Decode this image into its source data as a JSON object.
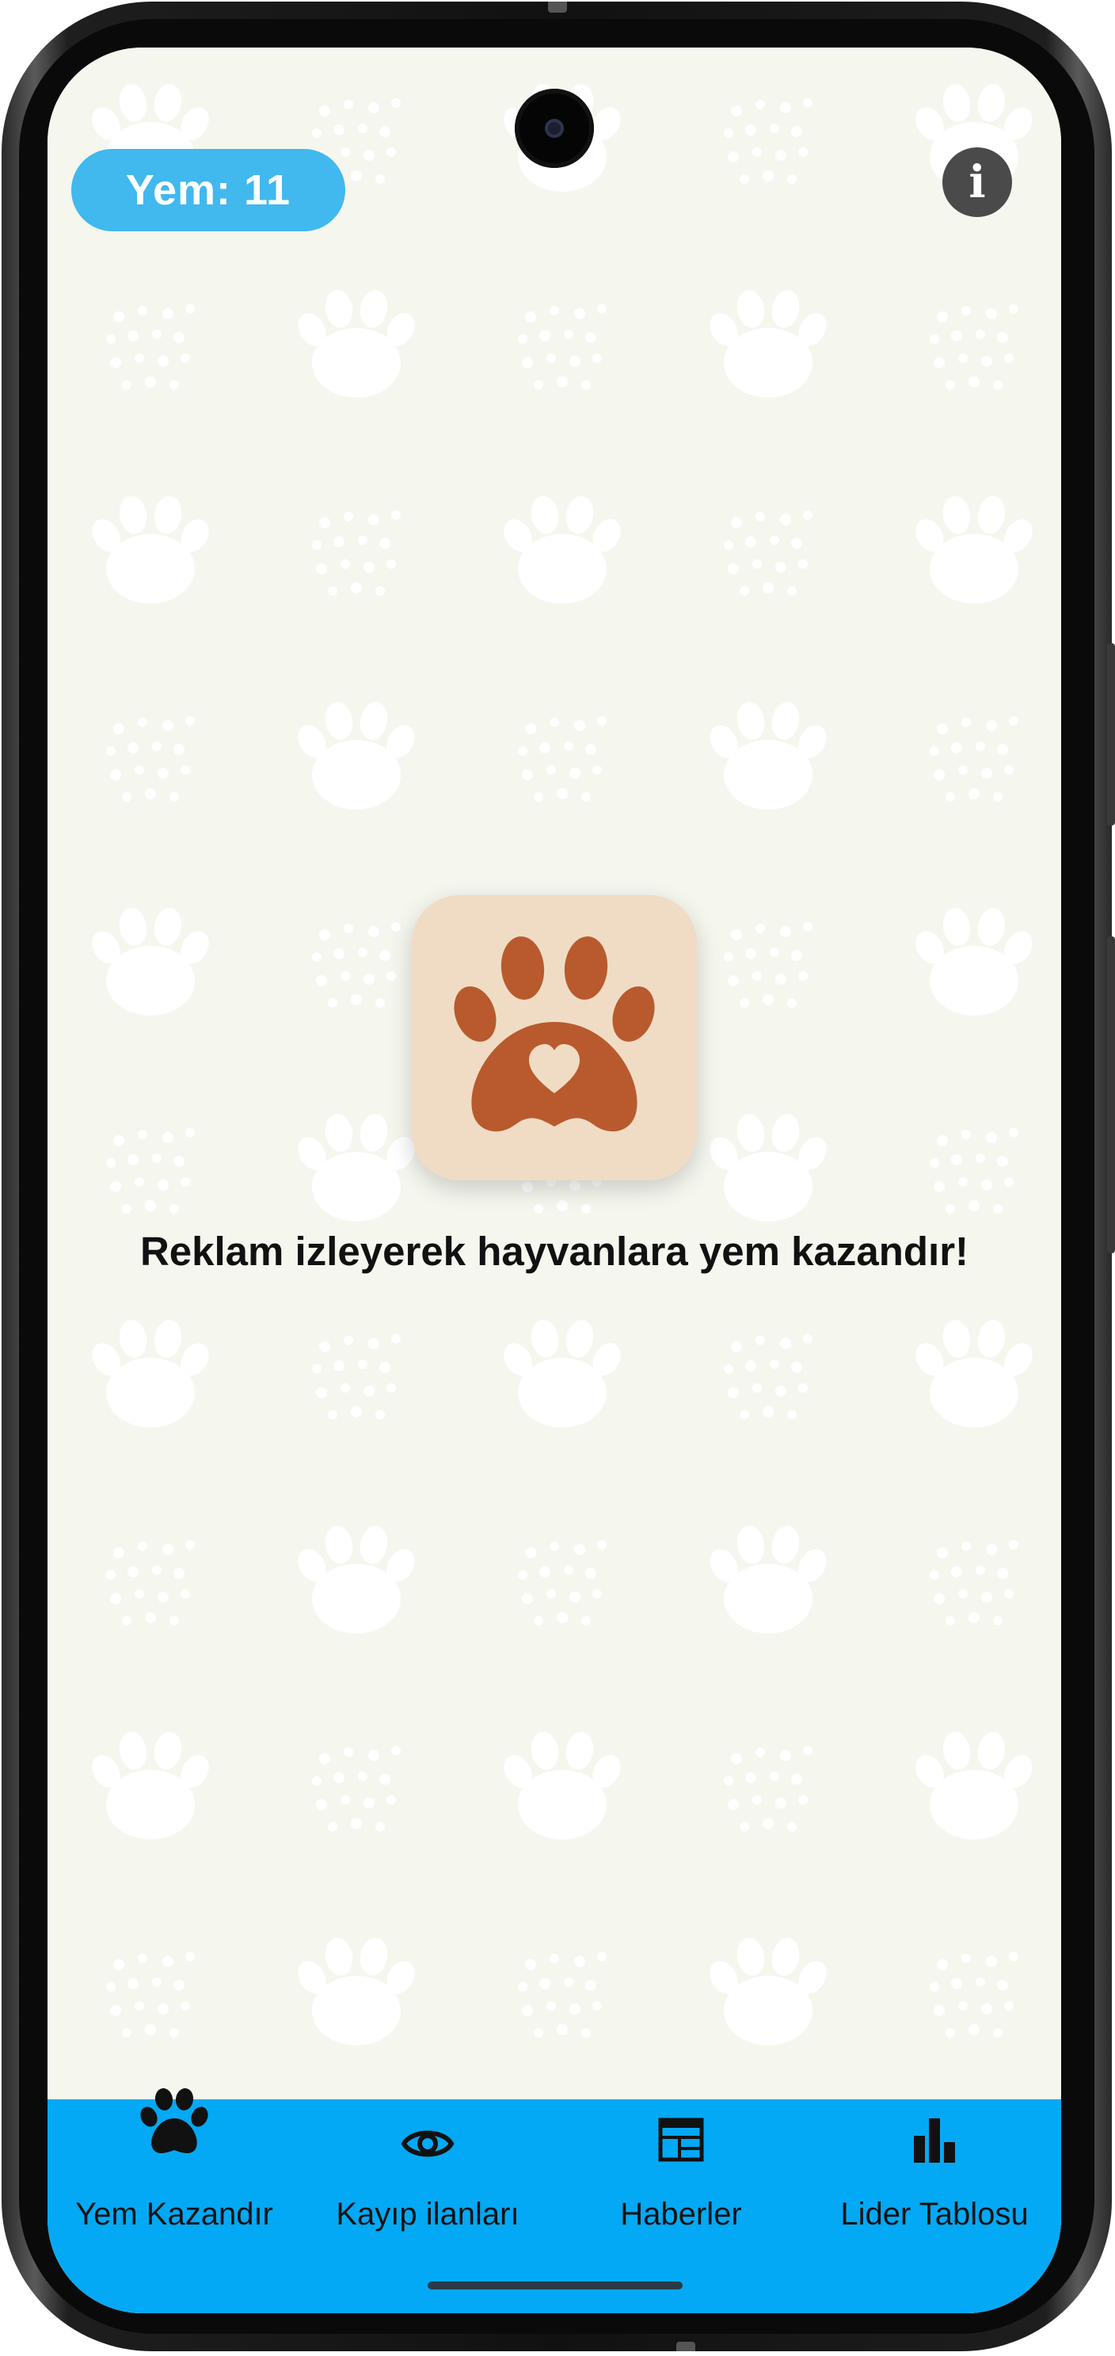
{
  "app": {
    "feed_counter": "Yem: 11",
    "info_glyph": "i",
    "tagline": "Reklam izleyerek hayvanlara yem kazandır!"
  },
  "bottom_nav": {
    "items": [
      {
        "label": "Yem Kazandır",
        "icon": "paw-icon",
        "active": true
      },
      {
        "label": "Kayıp ilanları",
        "icon": "eye-icon",
        "active": false
      },
      {
        "label": "Haberler",
        "icon": "newspaper-icon",
        "active": false
      },
      {
        "label": "Lider Tablosu",
        "icon": "leaderboard-icon",
        "active": false
      }
    ]
  },
  "colors": {
    "background": "#f5f6ee",
    "accent": "#41b8ee",
    "nav_bar": "#03a9f4",
    "logo_card": "#f0dcc4",
    "logo_paw": "#b85a2e",
    "info_button": "#4a4a4a"
  }
}
